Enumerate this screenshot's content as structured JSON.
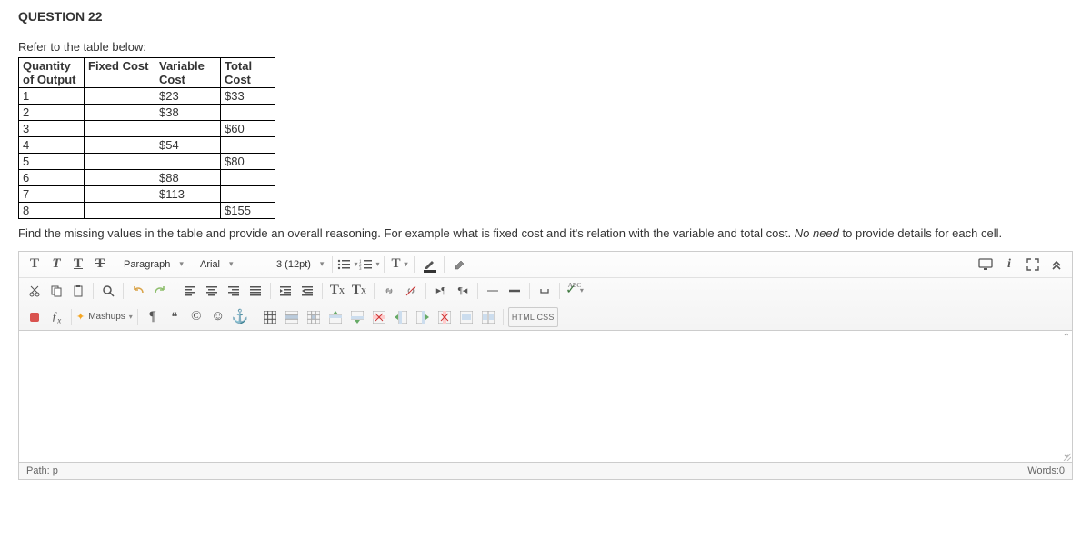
{
  "question": {
    "title": "QUESTION 22"
  },
  "refer": "Refer to the table below:",
  "table": {
    "headers": [
      "Quantity of Output",
      "Fixed Cost",
      "Variable Cost",
      "Total Cost"
    ],
    "rows": [
      {
        "qty": "1",
        "fixed": "",
        "variable": "$23",
        "total": "$33"
      },
      {
        "qty": "2",
        "fixed": "",
        "variable": "$38",
        "total": ""
      },
      {
        "qty": "3",
        "fixed": "",
        "variable": "",
        "total": "$60"
      },
      {
        "qty": "4",
        "fixed": "",
        "variable": "$54",
        "total": ""
      },
      {
        "qty": "5",
        "fixed": "",
        "variable": "",
        "total": "$80"
      },
      {
        "qty": "6",
        "fixed": "",
        "variable": "$88",
        "total": ""
      },
      {
        "qty": "7",
        "fixed": "",
        "variable": "$113",
        "total": ""
      },
      {
        "qty": "8",
        "fixed": "",
        "variable": "",
        "total": "$155"
      }
    ]
  },
  "instruction": {
    "text_a": "Find the missing values in the table and provide an overall reasoning. For example what is fixed cost and it's relation with the variable and total cost. ",
    "emph": "No need",
    "text_b": " to provide details for each cell."
  },
  "toolbar": {
    "paragraph": "Paragraph",
    "font": "Arial",
    "size": "3 (12pt)",
    "mashups": "Mashups",
    "htmlcss": "HTML CSS",
    "bold": "T",
    "italic": "T",
    "underline": "T",
    "strike": "T",
    "sup": "x",
    "sub": "x",
    "quote": "❝",
    "copyright": "©",
    "smiley": "☺",
    "anchor": "⚓",
    "pilcrow": "¶",
    "ltr": "▸¶",
    "rtl": "¶◂",
    "uni_t": "T",
    "fx": "ƒ",
    "fx_sub": "x"
  },
  "footer": {
    "path_label": "Path: ",
    "path_value": "p",
    "words_label": "Words:",
    "words_count": "0"
  }
}
